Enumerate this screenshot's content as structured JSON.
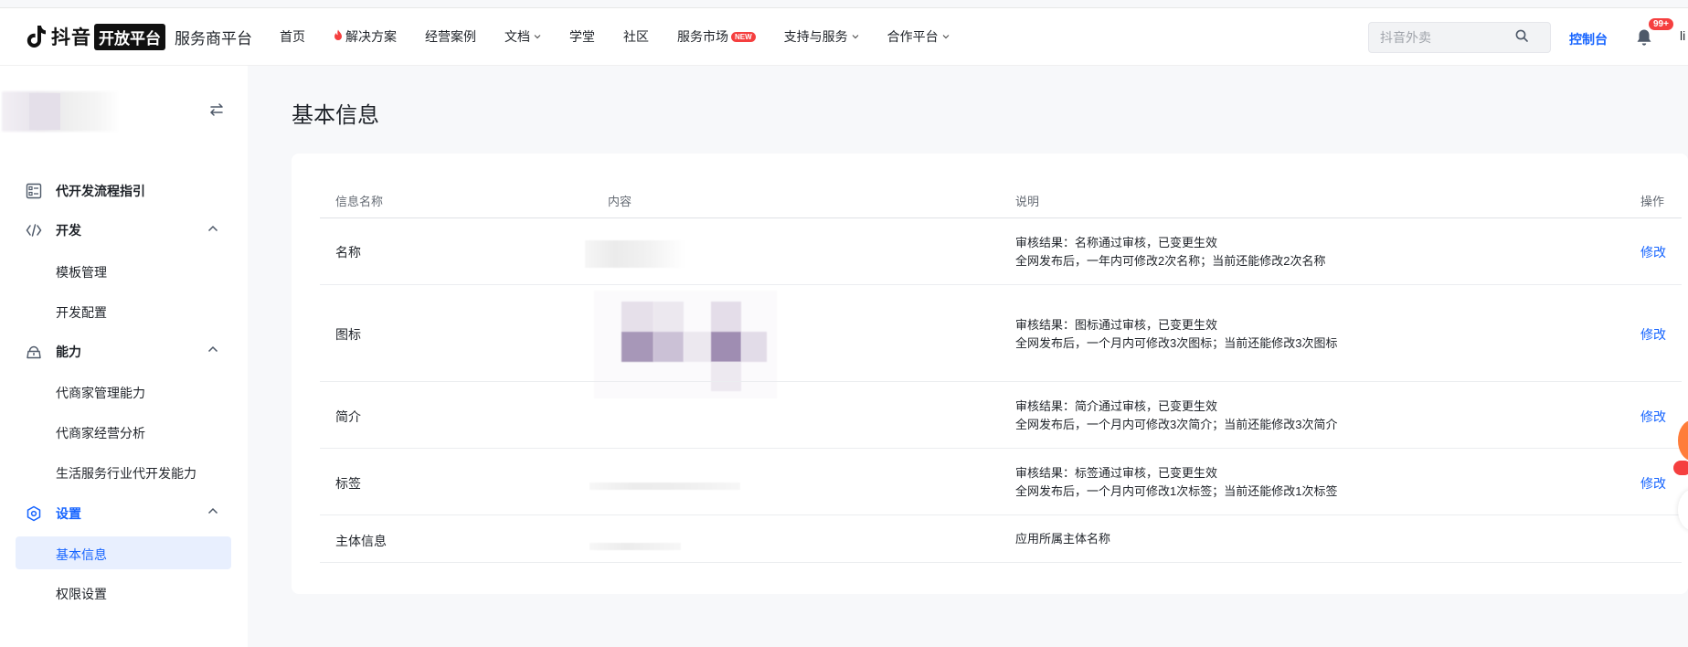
{
  "header": {
    "brand": "抖音",
    "badge": "开放平台",
    "subtitle": "服务商平台",
    "nav": [
      {
        "label": "首页",
        "hot": false,
        "caret": false,
        "isnew": false
      },
      {
        "label": "解决方案",
        "hot": true,
        "caret": false,
        "isnew": false
      },
      {
        "label": "经营案例",
        "hot": false,
        "caret": false,
        "isnew": false
      },
      {
        "label": "文档",
        "hot": false,
        "caret": true,
        "isnew": false
      },
      {
        "label": "学堂",
        "hot": false,
        "caret": false,
        "isnew": false
      },
      {
        "label": "社区",
        "hot": false,
        "caret": false,
        "isnew": false
      },
      {
        "label": "服务市场",
        "hot": false,
        "caret": false,
        "isnew": true
      },
      {
        "label": "支持与服务",
        "hot": false,
        "caret": true,
        "isnew": false
      },
      {
        "label": "合作平台",
        "hot": false,
        "caret": true,
        "isnew": false
      }
    ],
    "new_badge": "NEW",
    "search_placeholder": "抖音外卖",
    "console_label": "控制台",
    "bell_count": "99+",
    "user_initial": "li"
  },
  "sidebar": {
    "guide": "代开发流程指引",
    "groups": [
      {
        "label": "开发",
        "children": [
          "模板管理",
          "开发配置"
        ]
      },
      {
        "label": "能力",
        "children": [
          "代商家管理能力",
          "代商家经营分析",
          "生活服务行业代开发能力"
        ]
      },
      {
        "label": "设置",
        "children": [
          "基本信息",
          "权限设置"
        ]
      }
    ],
    "active_item": "基本信息"
  },
  "main": {
    "title": "基本信息",
    "columns": [
      "信息名称",
      "内容",
      "说明",
      "操作"
    ],
    "rows": [
      {
        "name": "名称",
        "desc1": "审核结果：名称通过审核，已变更生效",
        "desc2": "全网发布后，一年内可修改2次名称；当前还能修改2次名称",
        "op": "修改"
      },
      {
        "name": "图标",
        "desc1": "审核结果：图标通过审核，已变更生效",
        "desc2": "全网发布后，一个月内可修改3次图标；当前还能修改3次图标",
        "op": "修改"
      },
      {
        "name": "简介",
        "desc1": "审核结果：简介通过审核，已变更生效",
        "desc2": "全网发布后，一个月内可修改3次简介；当前还能修改3次简介",
        "op": "修改"
      },
      {
        "name": "标签",
        "desc1": "审核结果：标签通过审核，已变更生效",
        "desc2": "全网发布后，一个月内可修改1次标签；当前还能修改1次标签",
        "op": "修改"
      },
      {
        "name": "主体信息",
        "desc1": "应用所属主体名称",
        "desc2": "",
        "op": ""
      }
    ]
  },
  "colors": {
    "accent": "#1664ff",
    "danger": "#f53f3f",
    "active_bg": "#e8effe"
  }
}
